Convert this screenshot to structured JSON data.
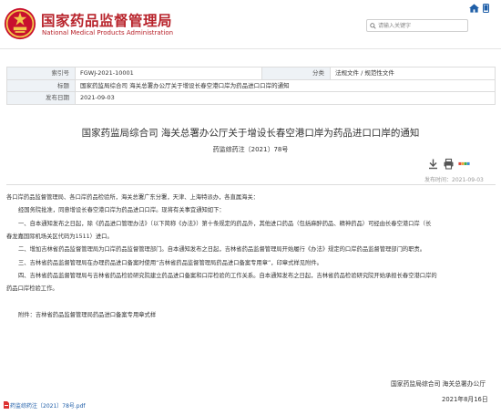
{
  "header": {
    "org_name_cn": "国家药品监督管理局",
    "org_name_en": "National Medical Products Administration",
    "search_placeholder": "请输入关键字"
  },
  "meta": {
    "rows": [
      {
        "label": "索引号",
        "value": "FGWJ-2021-10001",
        "label2": "分类",
        "value2": "法规文件 / 规范性文件"
      },
      {
        "label": "标题",
        "value": "国家药监局综合司 海关总署办公厅关于增设长春空港口岸为药品进口口岸的通知"
      },
      {
        "label": "发布日期",
        "value": "2021-09-03"
      }
    ]
  },
  "document": {
    "title": "国家药监局综合司 海关总署办公厅关于增设长春空港口岸为药品进口口岸的通知",
    "doc_number": "药监综药注〔2021〕78号",
    "publish_time": "发布时间：2021-09-03",
    "paragraphs": [
      "各口岸药品监督管理局、各口岸药品检验所，海关总署广东分署，天津、上海特派办，各直属海关：",
      "经国务院批准，同意增设长春空港口岸为药品进口口岸。现将有关事宜通知如下：",
      "一、自本通知发布之日起，除《药品进口管理办法》（以下简称《办法》）第十条规定的药品外，其他进口药品（包括麻醉药品、精神药品）可经由长春空港口岸（长",
      "春龙嘉国际机场关区代码为1511）进口。",
      "二、增加吉林省药品监督管理局为口岸药品监督管理部门。自本通知发布之日起，吉林省药品监督管理局开始履行《办法》规定的口岸药品监督管理部门的职责。",
      "三、吉林省药品监督管理局在办理药品进口备案时使用“吉林省药品监督管理局药品进口备案专用章”，印章式样见附件。",
      "四、吉林省药品监督管理局与吉林省药品检验研究院建立药品进口备案和口岸检验的工作关系。自本通知发布之日起，吉林省药品检验研究院开始承担长春空港口岸的",
      "药品口岸检验工作。",
      "附件：吉林省药品监督管理局药品进口备案专用章式样"
    ],
    "signature_org": "国家药监局综合司 海关总署办公厅",
    "signature_date": "2021年8月16日",
    "attachment_link": "药监综药注〔2021〕78号.pdf"
  },
  "icons": {
    "emblem": "national-emblem-icon",
    "search": "search-icon",
    "home": "home-icon",
    "mobile": "mobile-icon",
    "download": "download-icon",
    "print": "print-icon",
    "share": "share-icon",
    "pdf": "pdf-icon"
  },
  "colors": {
    "brand_red": "#b8232b",
    "link_blue": "#1a5aa6",
    "label_bg": "#eef2f6"
  }
}
